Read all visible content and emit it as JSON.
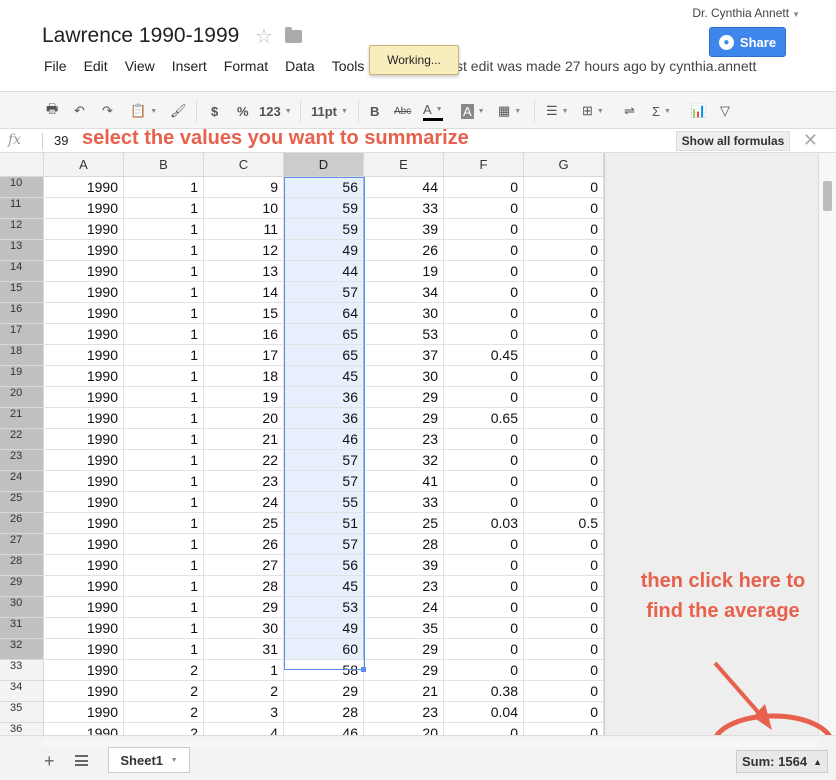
{
  "user": {
    "name": "Dr. Cynthia Annett"
  },
  "doc": {
    "title": "Lawrence 1990-1999",
    "share_label": "Share"
  },
  "menu": [
    "File",
    "Edit",
    "View",
    "Insert",
    "Format",
    "Data",
    "Tools"
  ],
  "status": {
    "working_label": "Working...",
    "last_edit": "st edit was made 27 hours ago by cynthia.annett"
  },
  "toolbar": {
    "currency": "$",
    "percent": "%",
    "number_format": "123",
    "font_size": "11pt",
    "bold": "B",
    "strike": "Abc",
    "text_color": "A",
    "fill_color": "A",
    "sum": "Σ"
  },
  "formula": {
    "fx_label": "fx",
    "value": "39",
    "show_all_label": "Show all formulas"
  },
  "annotations": {
    "top": "select the values you want to summarize",
    "bottom": "then click here to find the average"
  },
  "grid": {
    "columns": [
      "A",
      "B",
      "C",
      "D",
      "E",
      "F",
      "G"
    ],
    "selected_column": "D",
    "rows": [
      {
        "n": "10",
        "v": [
          "1990",
          "1",
          "9",
          "56",
          "44",
          "0",
          "0"
        ]
      },
      {
        "n": "11",
        "v": [
          "1990",
          "1",
          "10",
          "59",
          "33",
          "0",
          "0"
        ]
      },
      {
        "n": "12",
        "v": [
          "1990",
          "1",
          "11",
          "59",
          "39",
          "0",
          "0"
        ]
      },
      {
        "n": "13",
        "v": [
          "1990",
          "1",
          "12",
          "49",
          "26",
          "0",
          "0"
        ]
      },
      {
        "n": "14",
        "v": [
          "1990",
          "1",
          "13",
          "44",
          "19",
          "0",
          "0"
        ]
      },
      {
        "n": "15",
        "v": [
          "1990",
          "1",
          "14",
          "57",
          "34",
          "0",
          "0"
        ]
      },
      {
        "n": "16",
        "v": [
          "1990",
          "1",
          "15",
          "64",
          "30",
          "0",
          "0"
        ]
      },
      {
        "n": "17",
        "v": [
          "1990",
          "1",
          "16",
          "65",
          "53",
          "0",
          "0"
        ]
      },
      {
        "n": "18",
        "v": [
          "1990",
          "1",
          "17",
          "65",
          "37",
          "0.45",
          "0"
        ]
      },
      {
        "n": "19",
        "v": [
          "1990",
          "1",
          "18",
          "45",
          "30",
          "0",
          "0"
        ]
      },
      {
        "n": "20",
        "v": [
          "1990",
          "1",
          "19",
          "36",
          "29",
          "0",
          "0"
        ]
      },
      {
        "n": "21",
        "v": [
          "1990",
          "1",
          "20",
          "36",
          "29",
          "0.65",
          "0"
        ]
      },
      {
        "n": "22",
        "v": [
          "1990",
          "1",
          "21",
          "46",
          "23",
          "0",
          "0"
        ]
      },
      {
        "n": "23",
        "v": [
          "1990",
          "1",
          "22",
          "57",
          "32",
          "0",
          "0"
        ]
      },
      {
        "n": "24",
        "v": [
          "1990",
          "1",
          "23",
          "57",
          "41",
          "0",
          "0"
        ]
      },
      {
        "n": "25",
        "v": [
          "1990",
          "1",
          "24",
          "55",
          "33",
          "0",
          "0"
        ]
      },
      {
        "n": "26",
        "v": [
          "1990",
          "1",
          "25",
          "51",
          "25",
          "0.03",
          "0.5"
        ]
      },
      {
        "n": "27",
        "v": [
          "1990",
          "1",
          "26",
          "57",
          "28",
          "0",
          "0"
        ]
      },
      {
        "n": "28",
        "v": [
          "1990",
          "1",
          "27",
          "56",
          "39",
          "0",
          "0"
        ]
      },
      {
        "n": "29",
        "v": [
          "1990",
          "1",
          "28",
          "45",
          "23",
          "0",
          "0"
        ]
      },
      {
        "n": "30",
        "v": [
          "1990",
          "1",
          "29",
          "53",
          "24",
          "0",
          "0"
        ]
      },
      {
        "n": "31",
        "v": [
          "1990",
          "1",
          "30",
          "49",
          "35",
          "0",
          "0"
        ]
      },
      {
        "n": "32",
        "v": [
          "1990",
          "1",
          "31",
          "60",
          "29",
          "0",
          "0"
        ]
      },
      {
        "n": "33",
        "v": [
          "1990",
          "2",
          "1",
          "58",
          "29",
          "0",
          "0"
        ]
      },
      {
        "n": "34",
        "v": [
          "1990",
          "2",
          "2",
          "29",
          "21",
          "0.38",
          "0"
        ]
      },
      {
        "n": "35",
        "v": [
          "1990",
          "2",
          "3",
          "28",
          "23",
          "0.04",
          "0"
        ]
      },
      {
        "n": "36",
        "v": [
          "1990",
          "2",
          "4",
          "46",
          "20",
          "0",
          "0"
        ]
      }
    ],
    "selected_rows_through": "32"
  },
  "sheets": {
    "tab_label": "Sheet1",
    "add_label": "+"
  },
  "summary": {
    "label": "Sum: 1564"
  },
  "colors": {
    "accent": "#3f86ea",
    "annotation": "#e8614c",
    "selection": "#e8f0fd"
  }
}
